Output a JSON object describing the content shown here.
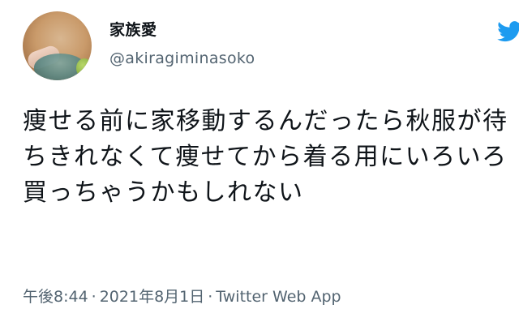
{
  "author": {
    "display_name": "家族愛",
    "handle": "@akiragiminasoko"
  },
  "tweet": {
    "text": "痩せる前に家移動するんだったら秋服が待ちきれなくて痩せてから着る用にいろいろ買っちゃうかもしれない"
  },
  "meta": {
    "time": "午後8:44",
    "separator": "·",
    "date": "2021年8月1日",
    "source": "Twitter Web App"
  },
  "icons": {
    "logo": "twitter-bird-icon"
  },
  "colors": {
    "text_primary": "#0f1419",
    "text_secondary": "#536471",
    "brand": "#1d9bf0"
  }
}
